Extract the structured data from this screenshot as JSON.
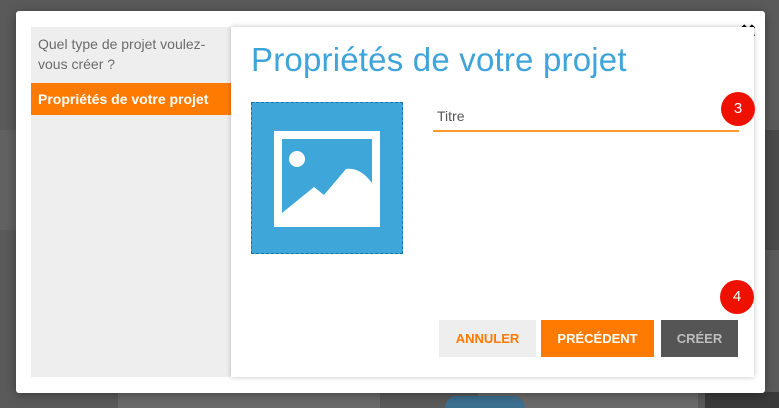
{
  "close": {
    "icon": "close-icon",
    "glyph": "✖"
  },
  "sidebar": {
    "steps": [
      {
        "label": "Quel type de projet voulez-vous créer ?",
        "active": false
      },
      {
        "label": "Propriétés de votre projet",
        "active": true
      }
    ]
  },
  "main": {
    "title": "Propriétés de votre projet",
    "image_placeholder_icon": "image-icon",
    "title_field": {
      "value": "",
      "placeholder": "Titre"
    }
  },
  "badges": {
    "field_step": "3",
    "buttons_step": "4"
  },
  "buttons": {
    "cancel": "ANNULER",
    "previous": "PRÉCÉDENT",
    "create": "CRÉER"
  },
  "colors": {
    "accent_orange": "#ff7a00",
    "title_blue": "#3fa4d9",
    "image_blue": "#3ea6d8",
    "badge_red": "#ee1100",
    "disabled_button": "#555555"
  }
}
